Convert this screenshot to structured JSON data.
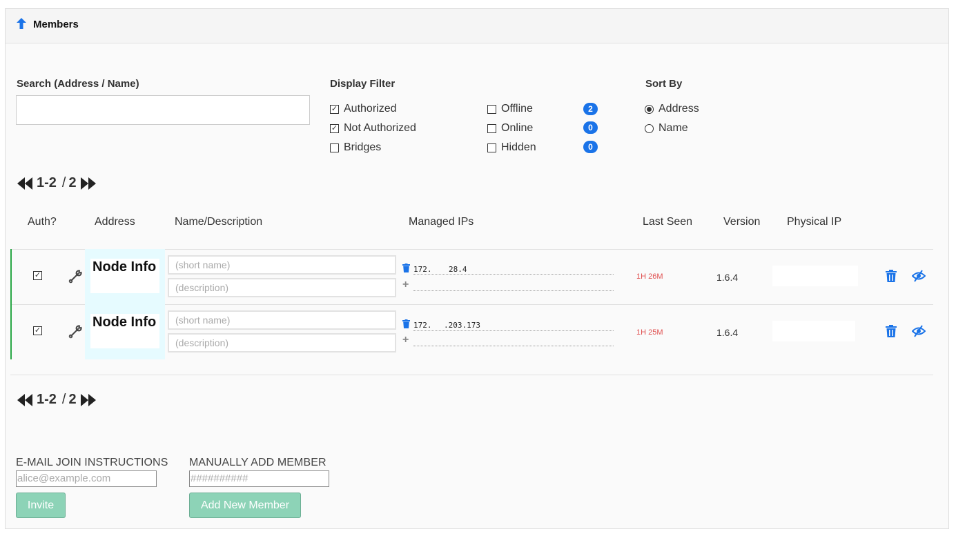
{
  "header": {
    "title": "Members",
    "icon": "arrow-up-icon"
  },
  "search": {
    "label": "Search (Address / Name)",
    "value": ""
  },
  "display_filter": {
    "label": "Display Filter",
    "options": [
      {
        "label": "Authorized",
        "checked": true
      },
      {
        "label": "Not Authorized",
        "checked": true
      },
      {
        "label": "Bridges",
        "checked": false
      },
      {
        "label": "Offline",
        "checked": false,
        "count": "2"
      },
      {
        "label": "Online",
        "checked": false,
        "count": "0"
      },
      {
        "label": "Hidden",
        "checked": false,
        "count": "0"
      }
    ]
  },
  "sort_by": {
    "label": "Sort By",
    "options": [
      {
        "label": "Address",
        "selected": true
      },
      {
        "label": "Name",
        "selected": false
      }
    ]
  },
  "pager": {
    "range": "1-2",
    "separator": "/",
    "total": "2"
  },
  "columns": {
    "auth": "Auth?",
    "address": "Address",
    "name": "Name/Description",
    "managed_ips": "Managed IPs",
    "last_seen": "Last Seen",
    "version": "Version",
    "physical_ip": "Physical IP"
  },
  "members": [
    {
      "authorized": true,
      "node_info": "Node Info",
      "short_name_placeholder": "(short name)",
      "description_placeholder": "(description)",
      "ip_prefix": "172.",
      "ip_suffix": "28.4",
      "last_seen": "1H 26M",
      "version": "1.6.4"
    },
    {
      "authorized": true,
      "node_info": "Node Info",
      "short_name_placeholder": "(short name)",
      "description_placeholder": "(description)",
      "ip_prefix": "172.",
      "ip_suffix": ".203.173",
      "last_seen": "1H 25M",
      "version": "1.6.4"
    }
  ],
  "email_join": {
    "label": "E-MAIL JOIN INSTRUCTIONS",
    "placeholder": "alice@example.com",
    "button": "Invite"
  },
  "manual_add": {
    "label": "MANUALLY ADD MEMBER",
    "placeholder": "##########",
    "button": "Add New Member"
  },
  "colors": {
    "accent": "#1a73e8",
    "authorized_border": "#28a745",
    "button": "#8dd3b7",
    "last_seen": "#e05050"
  }
}
